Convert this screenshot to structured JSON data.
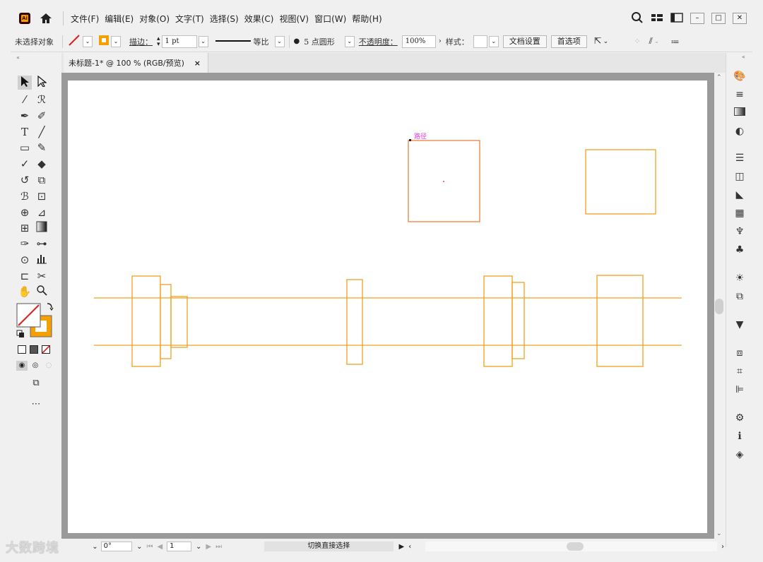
{
  "menubar": {
    "app_icon": "ai-logo",
    "app_icon_text": "Ai",
    "items": [
      "文件(F)",
      "编辑(E)",
      "对象(O)",
      "文字(T)",
      "选择(S)",
      "效果(C)",
      "视图(V)",
      "窗口(W)",
      "帮助(H)"
    ]
  },
  "controlbar": {
    "selection_status": "未选择对象",
    "stroke_label": "描边：",
    "stroke_weight": "1 pt",
    "profile_label": "等比",
    "brush_label": "5 点圆形",
    "opacity_label": "不透明度：",
    "opacity_value": "100%",
    "style_label": "样式：",
    "doc_setup_button": "文档设置",
    "preferences_button": "首选项"
  },
  "document": {
    "tab_title": "未标题-1* @ 100 % (RGB/预览)",
    "tab_close": "×",
    "path_label": "路径",
    "stroke_color": "#f0a020",
    "selected_color": "#f08040",
    "path_label_color": "#e040e0"
  },
  "statusbar": {
    "zoom_value": "0°",
    "page_value": "1",
    "status_text": "切换直接选择"
  },
  "watermark": "大数跨境"
}
